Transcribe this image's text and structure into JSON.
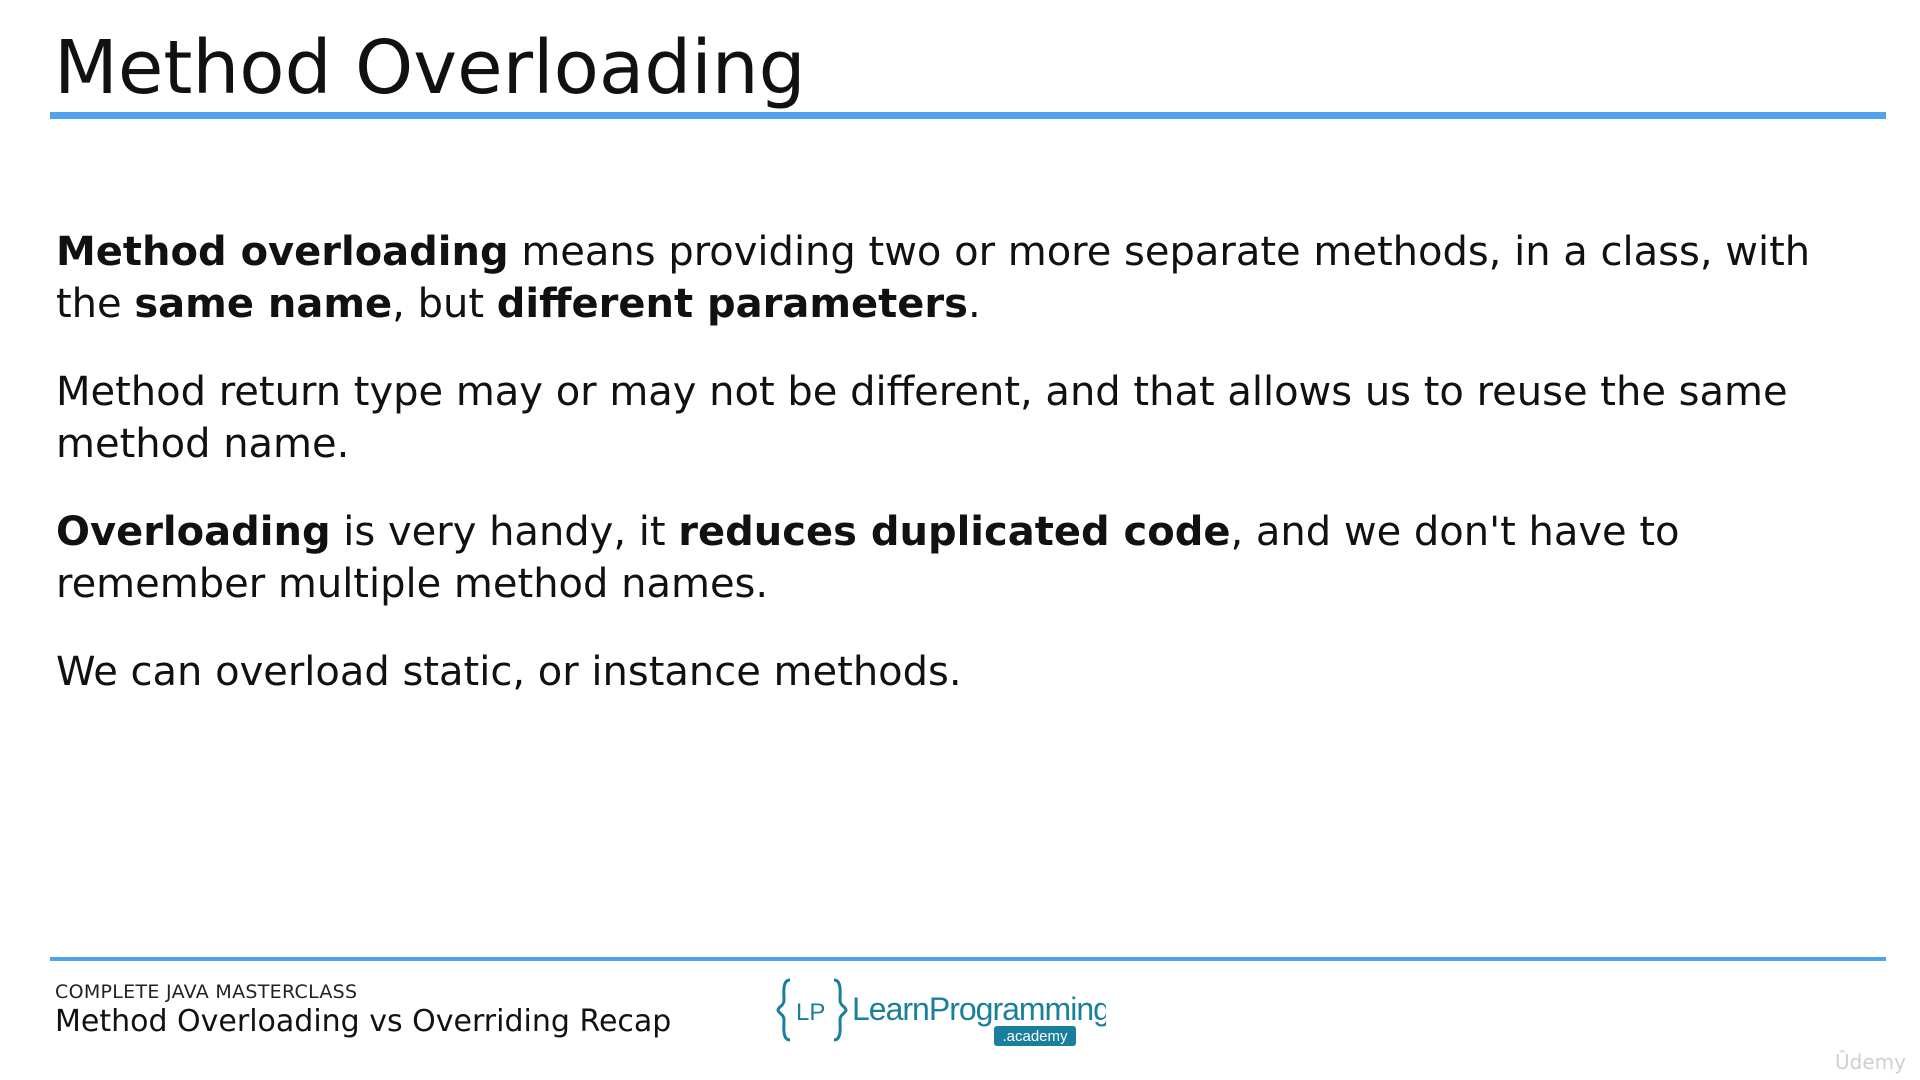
{
  "slide": {
    "title": "Method Overloading",
    "accent_color": "#4ea3ec"
  },
  "paragraphs": [
    {
      "parts": [
        {
          "text": "Method overloading",
          "bold": true
        },
        {
          "text": " means providing two or more separate methods, in a class, with the ",
          "bold": false
        },
        {
          "text": "same name",
          "bold": true
        },
        {
          "text": ", but ",
          "bold": false
        },
        {
          "text": "different parameters",
          "bold": true
        },
        {
          "text": ".",
          "bold": false
        }
      ]
    },
    {
      "parts": [
        {
          "text": "Method return type may or may not be different, and that allows us to reuse the same method name.",
          "bold": false
        }
      ]
    },
    {
      "parts": [
        {
          "text": "Overloading",
          "bold": true
        },
        {
          "text": " is very handy, it ",
          "bold": false
        },
        {
          "text": "reduces duplicated code",
          "bold": true
        },
        {
          "text": ", and we don't have to remember multiple method names.",
          "bold": false
        }
      ]
    },
    {
      "parts": [
        {
          "text": "We can overload static, or instance methods.",
          "bold": false
        }
      ]
    }
  ],
  "footer": {
    "course": "COMPLETE JAVA MASTERCLASS",
    "lecture": "Method Overloading vs Overriding Recap"
  },
  "logo": {
    "icon": "lp-braces-logo-icon",
    "text": "LearnProgramming",
    "tag": ".academy",
    "color": "#1a7f9c"
  },
  "watermark": "Ûdemy"
}
